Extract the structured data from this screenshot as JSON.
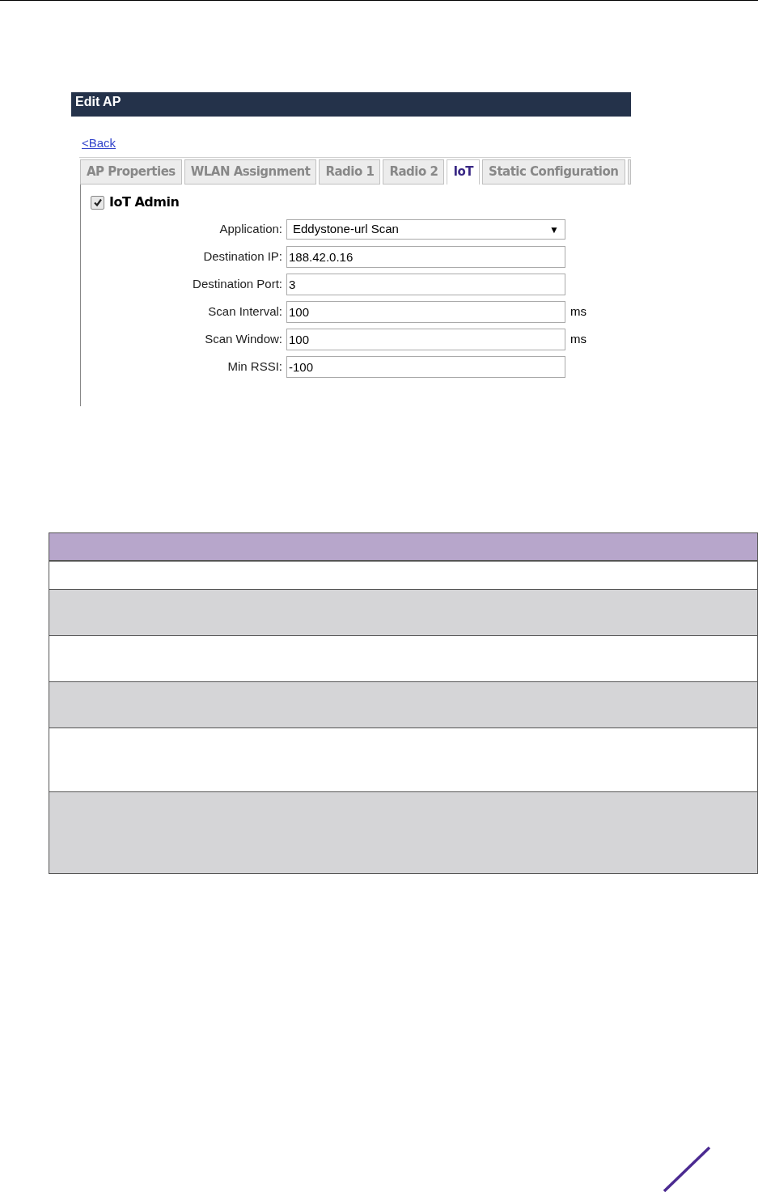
{
  "panel": {
    "title": "Edit AP",
    "back_link": "<Back",
    "tabs": [
      {
        "label": "AP Properties",
        "selected": false
      },
      {
        "label": "WLAN Assignment",
        "selected": false
      },
      {
        "label": "Radio 1",
        "selected": false
      },
      {
        "label": "Radio 2",
        "selected": false
      },
      {
        "label": "IoT",
        "selected": true
      },
      {
        "label": "Static Configuration",
        "selected": false
      }
    ],
    "iot_admin": {
      "label": "IoT Admin",
      "checked": true
    },
    "fields": [
      {
        "kind": "select",
        "label": "Application:",
        "value": "Eddystone-url Scan",
        "arrow": "▼"
      },
      {
        "kind": "text",
        "label": "Destination IP:",
        "value": "188.42.0.16"
      },
      {
        "kind": "text",
        "label": "Destination Port:",
        "value": "3"
      },
      {
        "kind": "text",
        "label": "Scan Interval:",
        "value": "100",
        "unit": "ms"
      },
      {
        "kind": "text",
        "label": "Scan Window:",
        "value": "100",
        "unit": "ms"
      },
      {
        "kind": "text",
        "label": "Min RSSI:",
        "value": "-100"
      }
    ]
  },
  "table": {
    "rows": [
      {
        "shaded": false
      },
      {
        "shaded": true
      },
      {
        "shaded": false
      },
      {
        "shaded": true
      },
      {
        "shaded": false
      },
      {
        "shaded": true
      }
    ]
  }
}
